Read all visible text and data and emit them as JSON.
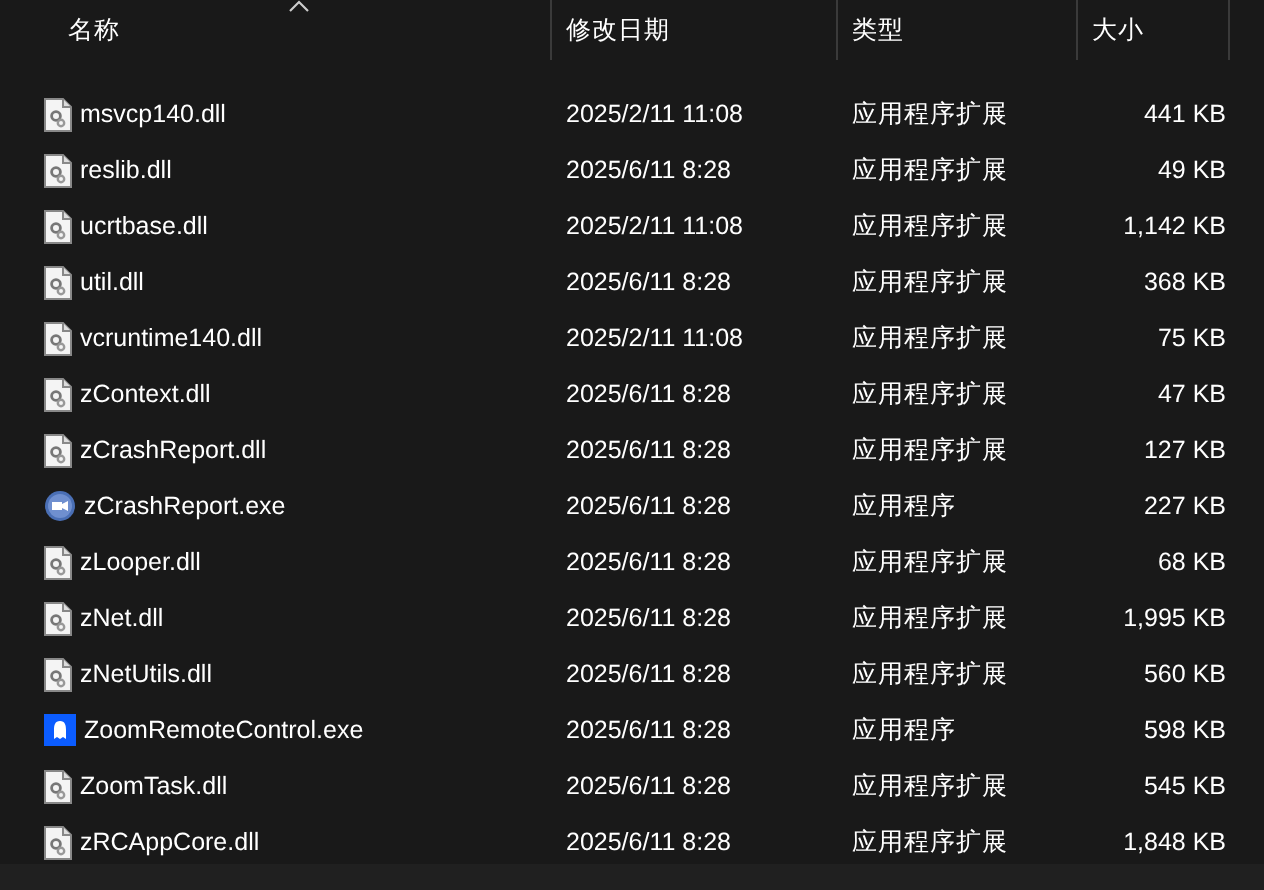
{
  "columns": [
    {
      "label": "名称",
      "sorted": true
    },
    {
      "label": "修改日期",
      "sorted": false
    },
    {
      "label": "类型",
      "sorted": false
    },
    {
      "label": "大小",
      "sorted": false
    }
  ],
  "files": [
    {
      "name": "msvcp140.dll",
      "date": "2025/2/11 11:08",
      "type": "应用程序扩展",
      "size": "441 KB",
      "kind": "dll"
    },
    {
      "name": "reslib.dll",
      "date": "2025/6/11 8:28",
      "type": "应用程序扩展",
      "size": "49 KB",
      "kind": "dll"
    },
    {
      "name": "ucrtbase.dll",
      "date": "2025/2/11 11:08",
      "type": "应用程序扩展",
      "size": "1,142 KB",
      "kind": "dll"
    },
    {
      "name": "util.dll",
      "date": "2025/6/11 8:28",
      "type": "应用程序扩展",
      "size": "368 KB",
      "kind": "dll"
    },
    {
      "name": "vcruntime140.dll",
      "date": "2025/2/11 11:08",
      "type": "应用程序扩展",
      "size": "75 KB",
      "kind": "dll"
    },
    {
      "name": "zContext.dll",
      "date": "2025/6/11 8:28",
      "type": "应用程序扩展",
      "size": "47 KB",
      "kind": "dll"
    },
    {
      "name": "zCrashReport.dll",
      "date": "2025/6/11 8:28",
      "type": "应用程序扩展",
      "size": "127 KB",
      "kind": "dll"
    },
    {
      "name": "zCrashReport.exe",
      "date": "2025/6/11 8:28",
      "type": "应用程序",
      "size": "227 KB",
      "kind": "round-exe"
    },
    {
      "name": "zLooper.dll",
      "date": "2025/6/11 8:28",
      "type": "应用程序扩展",
      "size": "68 KB",
      "kind": "dll"
    },
    {
      "name": "zNet.dll",
      "date": "2025/6/11 8:28",
      "type": "应用程序扩展",
      "size": "1,995 KB",
      "kind": "dll"
    },
    {
      "name": "zNetUtils.dll",
      "date": "2025/6/11 8:28",
      "type": "应用程序扩展",
      "size": "560 KB",
      "kind": "dll"
    },
    {
      "name": "ZoomRemoteControl.exe",
      "date": "2025/6/11 8:28",
      "type": "应用程序",
      "size": "598 KB",
      "kind": "square-exe"
    },
    {
      "name": "ZoomTask.dll",
      "date": "2025/6/11 8:28",
      "type": "应用程序扩展",
      "size": "545 KB",
      "kind": "dll"
    },
    {
      "name": "zRCAppCore.dll",
      "date": "2025/6/11 8:28",
      "type": "应用程序扩展",
      "size": "1,848 KB",
      "kind": "dll"
    }
  ]
}
